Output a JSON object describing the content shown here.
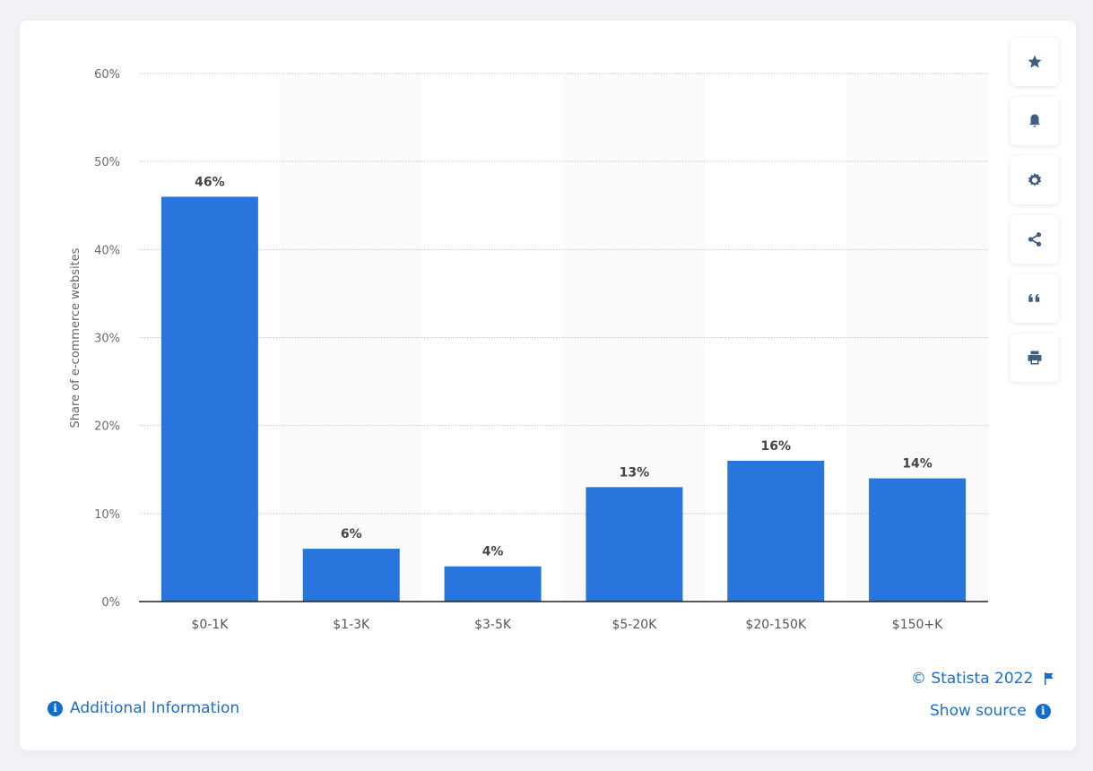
{
  "chart_data": {
    "type": "bar",
    "title": "",
    "xlabel": "",
    "ylabel": "Share of e-commerce websites",
    "categories": [
      "$0-1K",
      "$1-3K",
      "$3-5K",
      "$5-20K",
      "$20-150K",
      "$150+K"
    ],
    "values": [
      46,
      6,
      4,
      13,
      16,
      14
    ],
    "value_labels": [
      "46%",
      "6%",
      "4%",
      "13%",
      "16%",
      "14%"
    ],
    "ylim": [
      0,
      60
    ],
    "yticks": [
      0,
      10,
      20,
      30,
      40,
      50,
      60
    ],
    "ytick_labels": [
      "0%",
      "10%",
      "20%",
      "30%",
      "40%",
      "50%",
      "60%"
    ],
    "grid": true,
    "legend": "none",
    "colors": {
      "bar": "#2876dd",
      "band": "#fafafa",
      "grid": "#c8c8c8",
      "axis": "#222222"
    }
  },
  "sidebar": {
    "buttons": [
      {
        "name": "favorite",
        "icon": "star-icon"
      },
      {
        "name": "notifications",
        "icon": "bell-icon"
      },
      {
        "name": "settings",
        "icon": "gear-icon"
      },
      {
        "name": "share",
        "icon": "share-icon"
      },
      {
        "name": "cite",
        "icon": "quote-icon"
      },
      {
        "name": "print",
        "icon": "print-icon"
      }
    ]
  },
  "footer": {
    "additional_info": "Additional Information",
    "copyright": "© Statista 2022",
    "show_source": "Show source",
    "link_color": "#1b6fcc"
  }
}
